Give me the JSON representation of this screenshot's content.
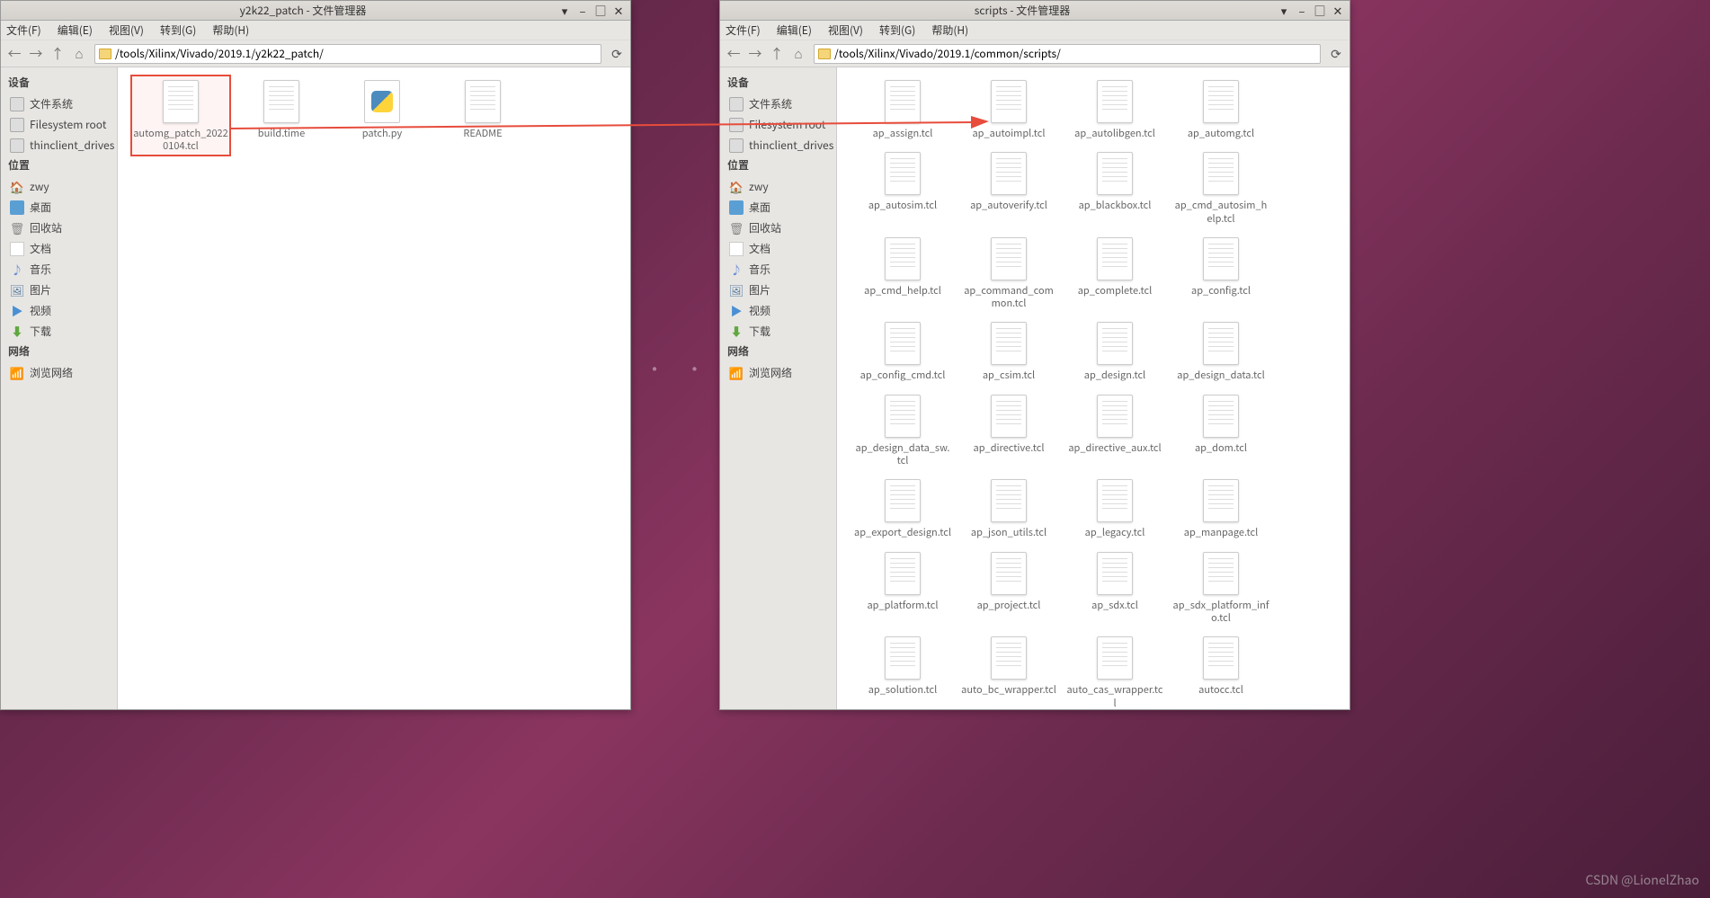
{
  "watermark": "CSDN @LionelZhao",
  "left_window": {
    "title": "y2k22_patch - 文件管理器",
    "menu": [
      "文件(F)",
      "编辑(E)",
      "视图(V)",
      "转到(G)",
      "帮助(H)"
    ],
    "path": "/tools/Xilinx/Vivado/2019.1/y2k22_patch/",
    "sidebar": {
      "devices_heading": "设备",
      "devices": [
        {
          "label": "文件系统",
          "ico": "ico-disk"
        },
        {
          "label": "Filesystem root",
          "ico": "ico-disk"
        },
        {
          "label": "thinclient_drives",
          "ico": "ico-disk"
        }
      ],
      "places_heading": "位置",
      "places": [
        {
          "label": "zwy",
          "ico": "ico-home"
        },
        {
          "label": "桌面",
          "ico": "ico-desktop"
        },
        {
          "label": "回收站",
          "ico": "ico-trash"
        },
        {
          "label": "文档",
          "ico": "ico-doc"
        },
        {
          "label": "音乐",
          "ico": "ico-music"
        },
        {
          "label": "图片",
          "ico": "ico-pics"
        },
        {
          "label": "视频",
          "ico": "ico-video"
        },
        {
          "label": "下载",
          "ico": "ico-download"
        }
      ],
      "network_heading": "网络",
      "network": [
        {
          "label": "浏览网络",
          "ico": "ico-network"
        }
      ]
    },
    "files": [
      {
        "name": "automg_patch_20220104.tcl",
        "type": "doc",
        "selected": true
      },
      {
        "name": "build.time",
        "type": "doc"
      },
      {
        "name": "patch.py",
        "type": "py"
      },
      {
        "name": "README",
        "type": "doc"
      }
    ]
  },
  "right_window": {
    "title": "scripts - 文件管理器",
    "menu": [
      "文件(F)",
      "编辑(E)",
      "视图(V)",
      "转到(G)",
      "帮助(H)"
    ],
    "path": "/tools/Xilinx/Vivado/2019.1/common/scripts/",
    "sidebar": {
      "devices_heading": "设备",
      "devices": [
        {
          "label": "文件系统",
          "ico": "ico-disk"
        },
        {
          "label": "Filesystem root",
          "ico": "ico-disk"
        },
        {
          "label": "thinclient_drives",
          "ico": "ico-disk"
        }
      ],
      "places_heading": "位置",
      "places": [
        {
          "label": "zwy",
          "ico": "ico-home"
        },
        {
          "label": "桌面",
          "ico": "ico-desktop"
        },
        {
          "label": "回收站",
          "ico": "ico-trash"
        },
        {
          "label": "文档",
          "ico": "ico-doc"
        },
        {
          "label": "音乐",
          "ico": "ico-music"
        },
        {
          "label": "图片",
          "ico": "ico-pics"
        },
        {
          "label": "视频",
          "ico": "ico-video"
        },
        {
          "label": "下载",
          "ico": "ico-download"
        }
      ],
      "network_heading": "网络",
      "network": [
        {
          "label": "浏览网络",
          "ico": "ico-network"
        }
      ]
    },
    "files": [
      {
        "name": "ap_assign.tcl"
      },
      {
        "name": "ap_autoimpl.tcl"
      },
      {
        "name": "ap_autolibgen.tcl"
      },
      {
        "name": "ap_automg.tcl"
      },
      {
        "name": "ap_autosim.tcl"
      },
      {
        "name": "ap_autoverify.tcl"
      },
      {
        "name": "ap_blackbox.tcl"
      },
      {
        "name": "ap_cmd_autosim_help.tcl"
      },
      {
        "name": "ap_cmd_help.tcl"
      },
      {
        "name": "ap_command_common.tcl"
      },
      {
        "name": "ap_complete.tcl"
      },
      {
        "name": "ap_config.tcl"
      },
      {
        "name": "ap_config_cmd.tcl"
      },
      {
        "name": "ap_csim.tcl"
      },
      {
        "name": "ap_design.tcl"
      },
      {
        "name": "ap_design_data.tcl"
      },
      {
        "name": "ap_design_data_sw.tcl"
      },
      {
        "name": "ap_directive.tcl"
      },
      {
        "name": "ap_directive_aux.tcl"
      },
      {
        "name": "ap_dom.tcl"
      },
      {
        "name": "ap_export_design.tcl"
      },
      {
        "name": "ap_json_utils.tcl"
      },
      {
        "name": "ap_legacy.tcl"
      },
      {
        "name": "ap_manpage.tcl"
      },
      {
        "name": "ap_platform.tcl"
      },
      {
        "name": "ap_project.tcl"
      },
      {
        "name": "ap_sdx.tcl"
      },
      {
        "name": "ap_sdx_platform_info.tcl"
      },
      {
        "name": "ap_solution.tcl"
      },
      {
        "name": "auto_bc_wrapper.tcl"
      },
      {
        "name": "auto_cas_wrapper.tcl"
      },
      {
        "name": "autocc.tcl"
      }
    ]
  }
}
